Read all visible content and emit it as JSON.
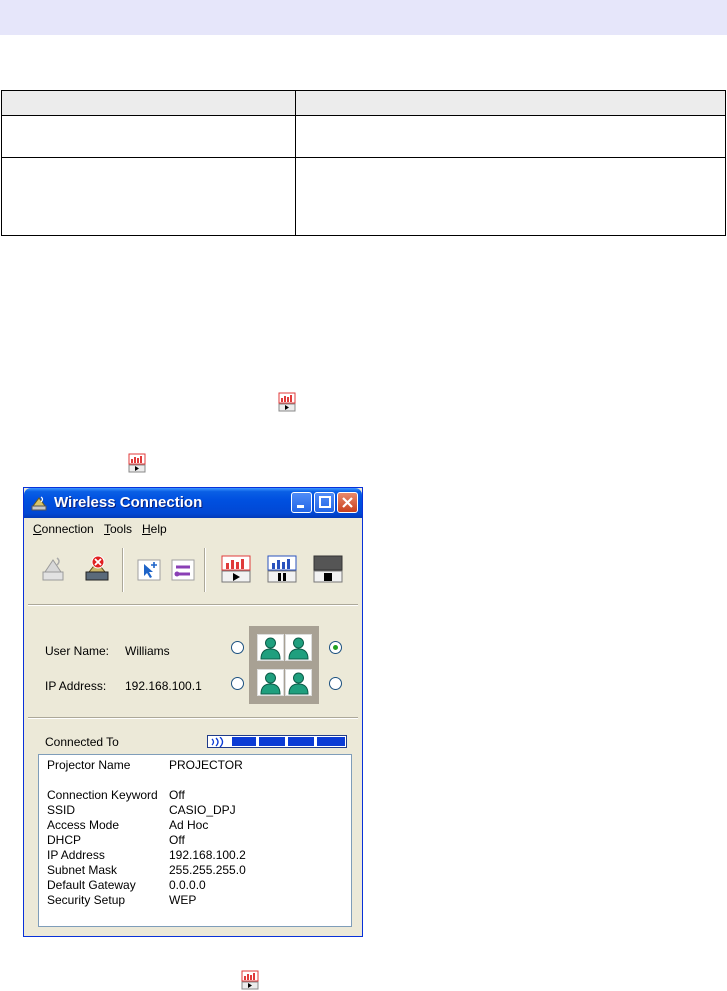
{
  "window": {
    "title": "Wireless Connection",
    "menu": [
      {
        "label_prefix": "",
        "mnemonic": "C",
        "label_rest": "onnection"
      },
      {
        "label_prefix": "",
        "mnemonic": "T",
        "label_rest": "ools"
      },
      {
        "label_prefix": "",
        "mnemonic": "H",
        "label_rest": "elp"
      }
    ],
    "user": {
      "name_label": "User Name:",
      "name_value": "Williams",
      "ip_label": "IP Address:",
      "ip_value": "192.168.100.1"
    },
    "connected_to_label": "Connected To",
    "signal_level": 1.0,
    "info": [
      {
        "label": "Projector Name",
        "value": "PROJECTOR"
      },
      {
        "label": "Connection Keyword",
        "value": "Off"
      },
      {
        "label": "SSID",
        "value": "CASIO_DPJ"
      },
      {
        "label": "Access Mode",
        "value": "Ad Hoc"
      },
      {
        "label": "DHCP",
        "value": "Off"
      },
      {
        "label": "IP Address",
        "value": "192.168.100.2"
      },
      {
        "label": "Subnet Mask",
        "value": "255.255.255.0"
      },
      {
        "label": "Default Gateway",
        "value": "0.0.0.0"
      },
      {
        "label": "Security Setup",
        "value": "WEP"
      }
    ]
  },
  "colors": {
    "header_band": "#e6e6fa",
    "titlebar": "#0050e0",
    "window_bg": "#ece9d8",
    "user_icon": "#1f9f7e",
    "signal": "#0b3bd5"
  },
  "icons": {
    "inline_icon": "projector-play-icon",
    "user_cell": "user-icon"
  }
}
